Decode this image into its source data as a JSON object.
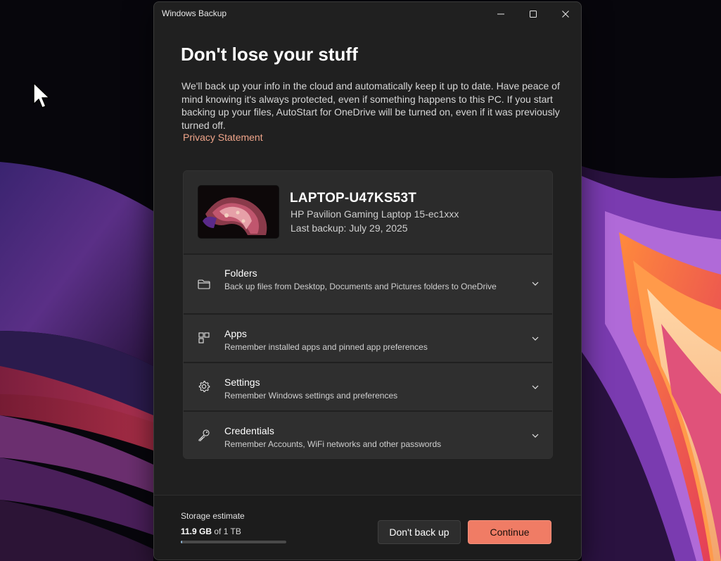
{
  "window": {
    "title": "Windows Backup"
  },
  "main": {
    "heading": "Don't lose your stuff",
    "description": "We'll back up your info in the cloud and automatically keep it up to date. Have peace of mind knowing it's always protected, even if something happens to this PC. If you start backing up your files, AutoStart for OneDrive will be turned on, even if it was previously turned off.",
    "privacy_link": "Privacy Statement"
  },
  "device": {
    "name": "LAPTOP-U47KS53T",
    "model": "HP Pavilion Gaming Laptop 15-ec1xxx",
    "last_backup": "Last backup: July 29, 2025"
  },
  "sections": [
    {
      "title": "Folders",
      "subtitle": "Back up files from Desktop, Documents and Pictures folders to OneDrive",
      "icon": "folder-icon"
    },
    {
      "title": "Apps",
      "subtitle": "Remember installed apps and pinned app preferences",
      "icon": "apps-icon"
    },
    {
      "title": "Settings",
      "subtitle": "Remember Windows settings and preferences",
      "icon": "gear-icon"
    },
    {
      "title": "Credentials",
      "subtitle": "Remember Accounts, WiFi networks and other passwords",
      "icon": "key-icon"
    }
  ],
  "footer": {
    "storage_label": "Storage estimate",
    "storage_used": "11.9 GB",
    "storage_total": "of 1 TB",
    "storage_fraction": 0.012,
    "dont_backup_label": "Don't back up",
    "continue_label": "Continue"
  },
  "colors": {
    "accent": "#f07c65",
    "link": "#f0a58a",
    "window_bg": "#202020",
    "card_bg": "#2b2b2b"
  }
}
